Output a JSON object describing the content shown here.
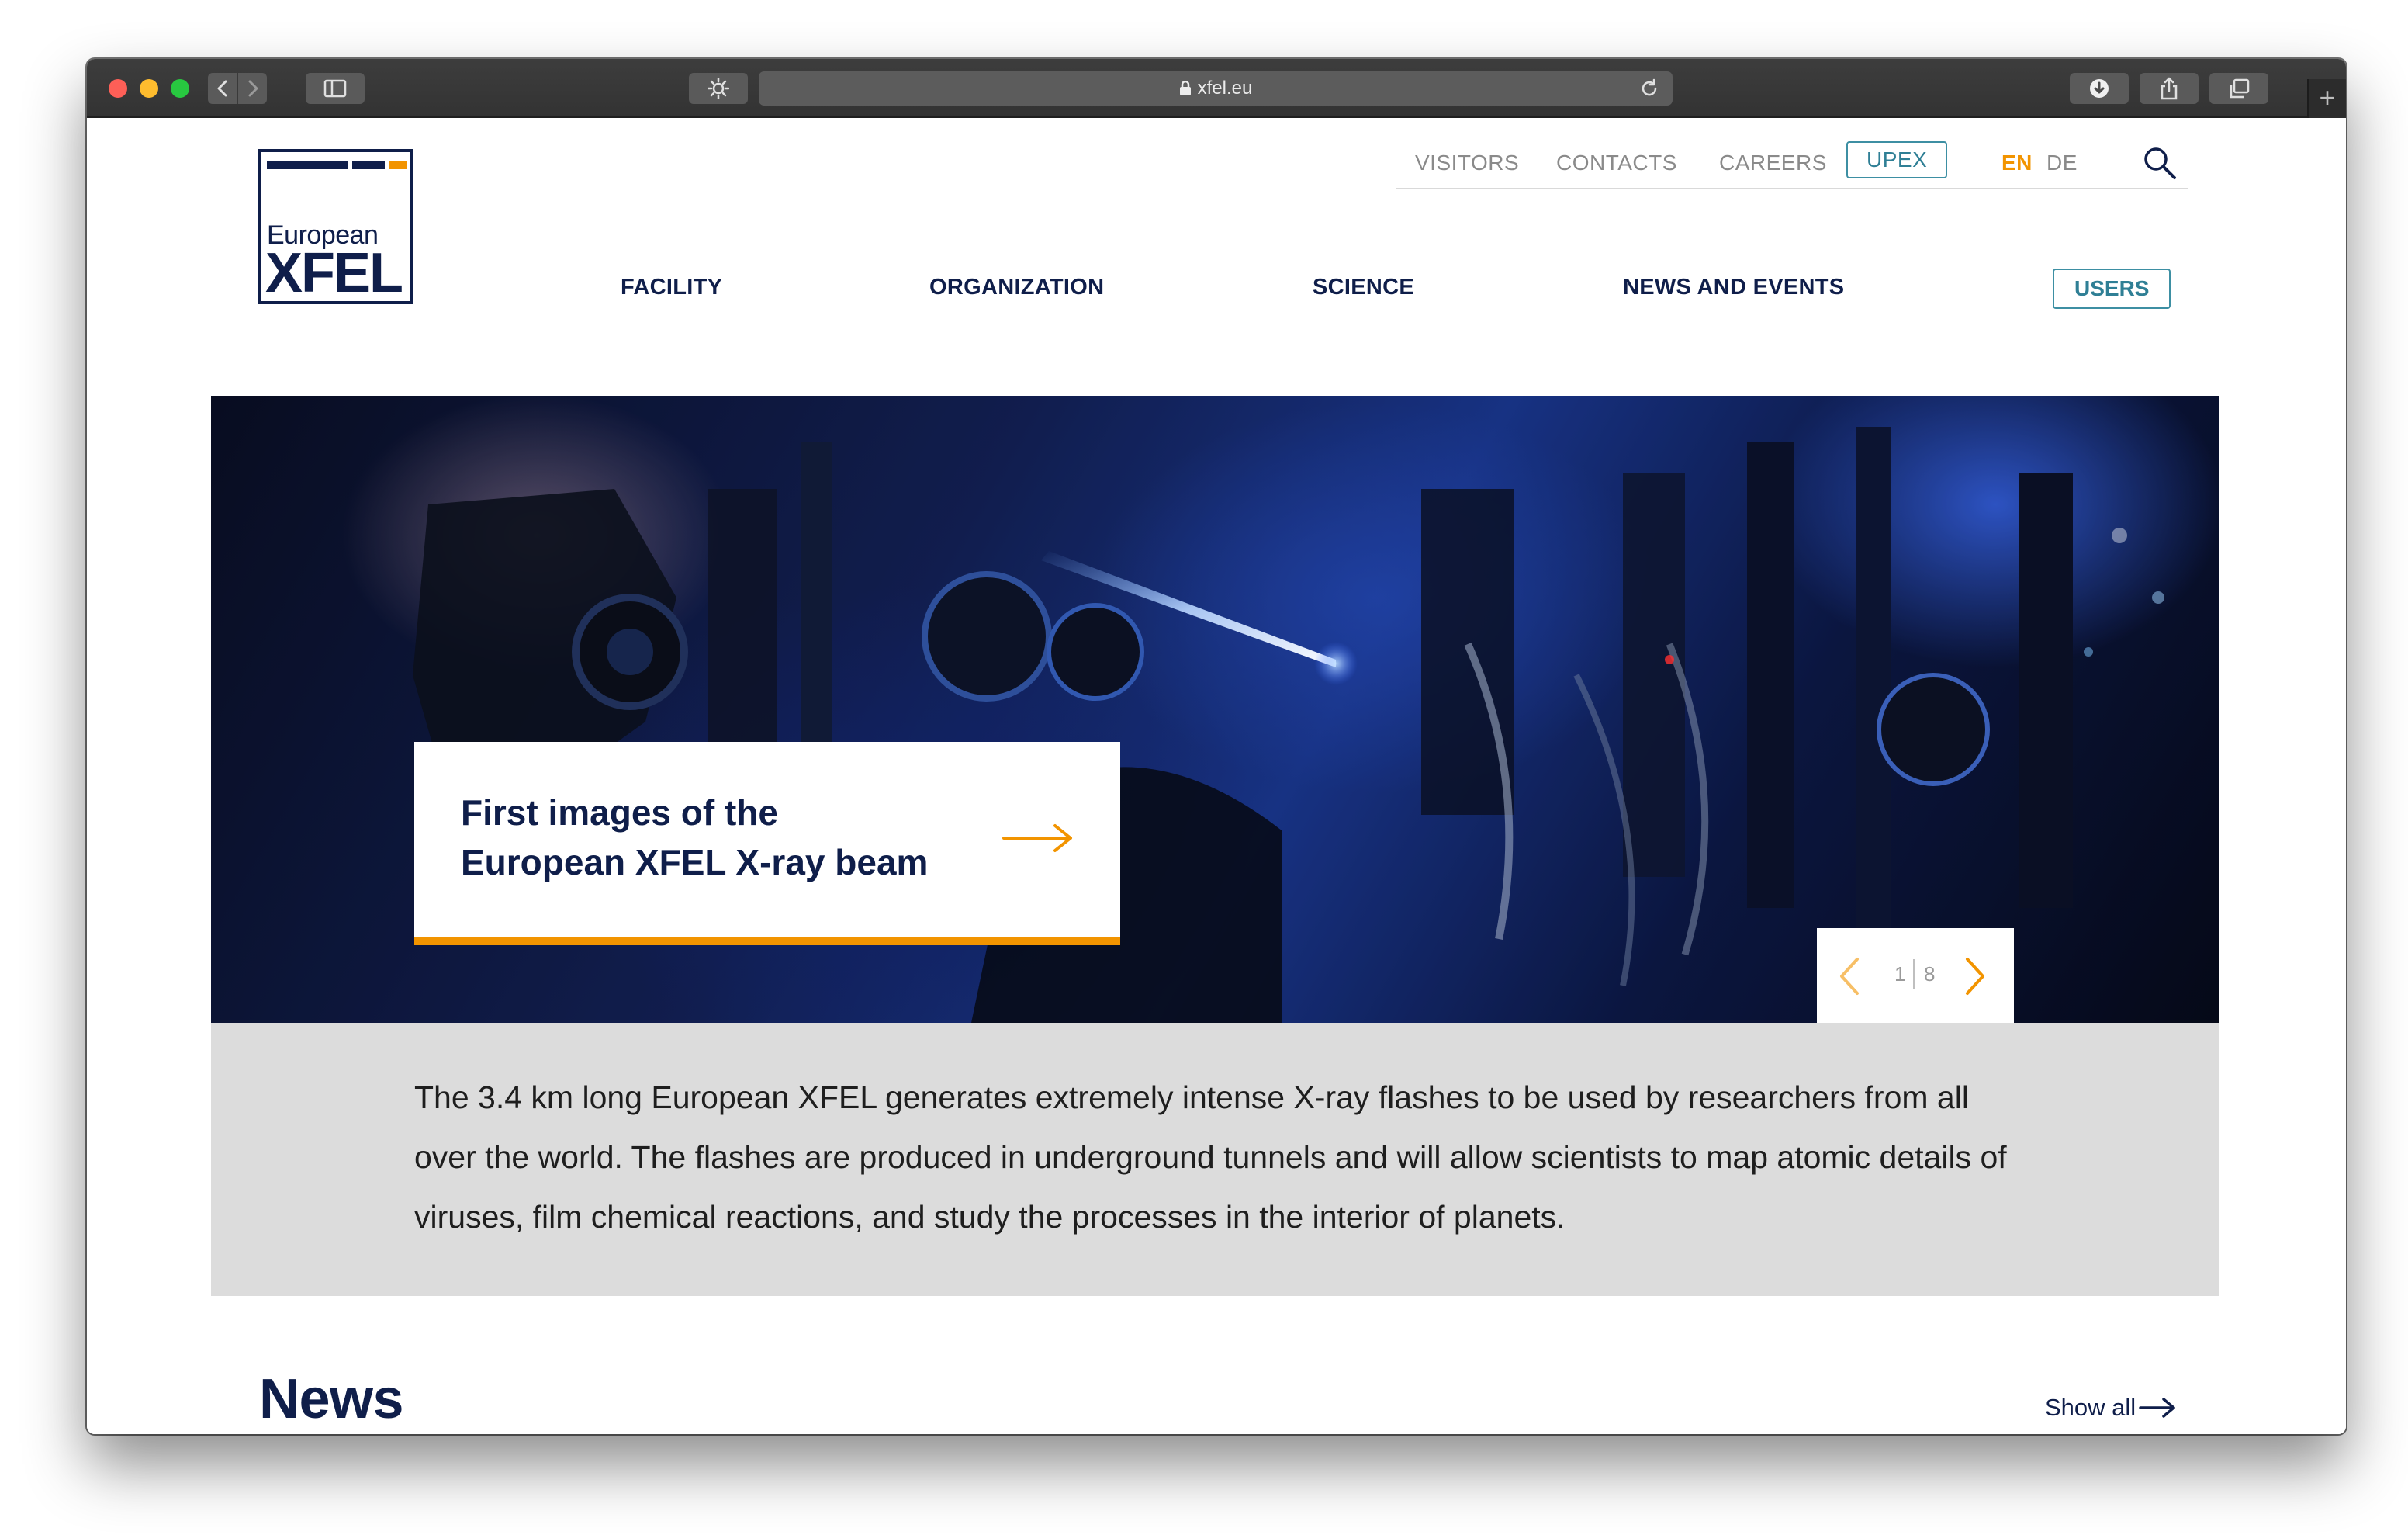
{
  "browser": {
    "url": "xfel.eu"
  },
  "logo": {
    "line1": "European",
    "line2": "XFEL"
  },
  "utility_nav": {
    "visitors": "VISITORS",
    "contacts": "CONTACTS",
    "careers": "CAREERS",
    "upex": "UPEX",
    "lang_en": "EN",
    "lang_de": "DE"
  },
  "main_nav": {
    "facility": "FACILITY",
    "organization": "ORGANIZATION",
    "science": "SCIENCE",
    "news_events": "NEWS AND EVENTS",
    "users": "USERS"
  },
  "hero": {
    "title_line1": "First images of the",
    "title_line2": "European XFEL X-ray beam",
    "current_slide": "1",
    "total_slides": "8"
  },
  "intro": {
    "text": "The 3.4 km long European XFEL generates extremely intense X-ray flashes to be used by researchers from all over the world. The flashes are produced in underground tunnels and will allow scientists to map atomic details of viruses, film chemical reactions, and study the processes in the interior of planets."
  },
  "news": {
    "heading": "News",
    "show_all": "Show all"
  },
  "colors": {
    "brand_navy": "#0f1e4a",
    "accent_orange": "#f29400",
    "teal": "#2f7f95",
    "intro_bg": "#dcdcdc"
  }
}
